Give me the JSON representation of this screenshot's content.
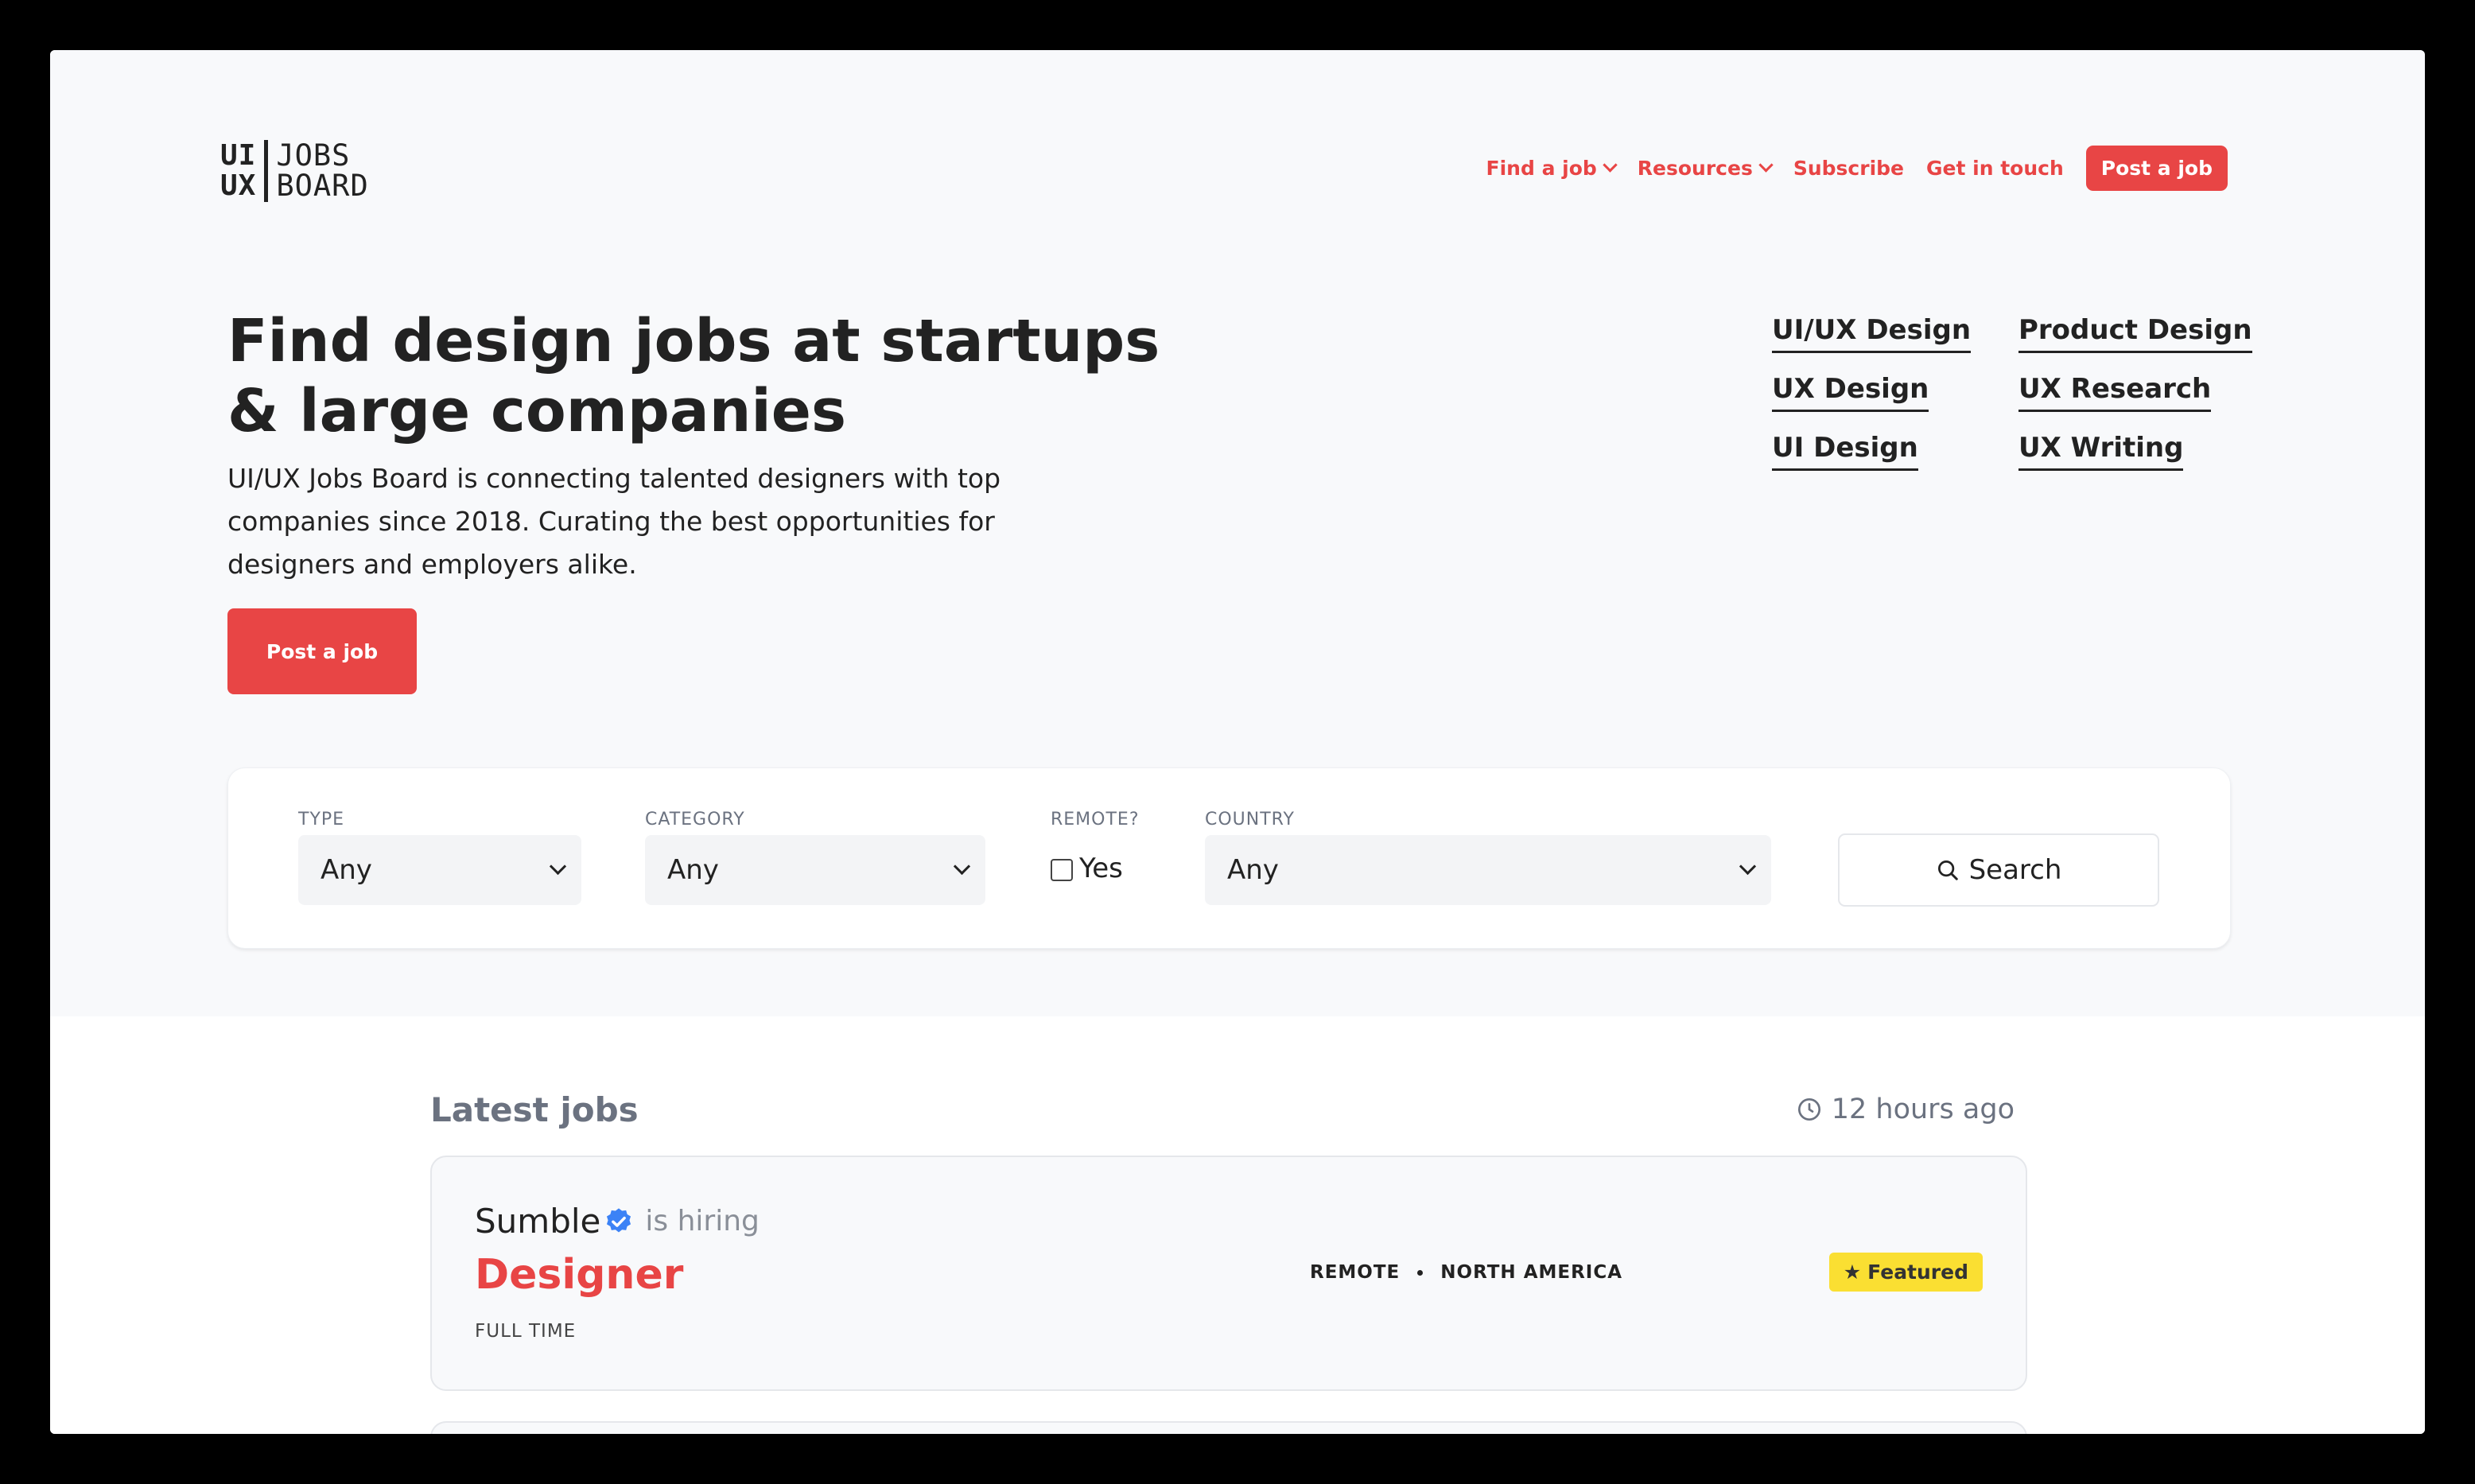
{
  "logo": {
    "ui": "UI",
    "ux": "UX",
    "jobs": "JOBS",
    "board": "BOARD"
  },
  "nav": {
    "find_job": "Find a job",
    "resources": "Resources",
    "subscribe": "Subscribe",
    "get_in_touch": "Get in touch",
    "post_job": "Post a job"
  },
  "hero": {
    "title": "Find design jobs at startups & large companies",
    "description": "UI/UX Jobs Board is connecting talented designers with top companies since 2018. Curating the best opportunities for designers and employers alike.",
    "cta": "Post a job"
  },
  "categories": [
    "UI/UX Design",
    "Product Design",
    "UX Design",
    "UX Research",
    "UI Design",
    "UX Writing"
  ],
  "filters": {
    "type_label": "TYPE",
    "type_value": "Any",
    "category_label": "CATEGORY",
    "category_value": "Any",
    "remote_label": "REMOTE?",
    "remote_option": "Yes",
    "country_label": "COUNTRY",
    "country_value": "Any",
    "search_label": "Search"
  },
  "latest": {
    "title": "Latest jobs",
    "updated": "12 hours ago"
  },
  "jobs": [
    {
      "company": "Sumble",
      "hiring_text": "is hiring",
      "role": "Designer",
      "type": "FULL TIME",
      "remote": "REMOTE",
      "region": "NORTH AMERICA",
      "badge": "Featured"
    }
  ],
  "colors": {
    "accent": "#e84545",
    "featured": "#fadf32",
    "verified": "#3b82f6"
  },
  "icons": [
    "chevron-down-icon",
    "search-icon",
    "clock-icon",
    "verified-badge-icon",
    "star-icon"
  ]
}
